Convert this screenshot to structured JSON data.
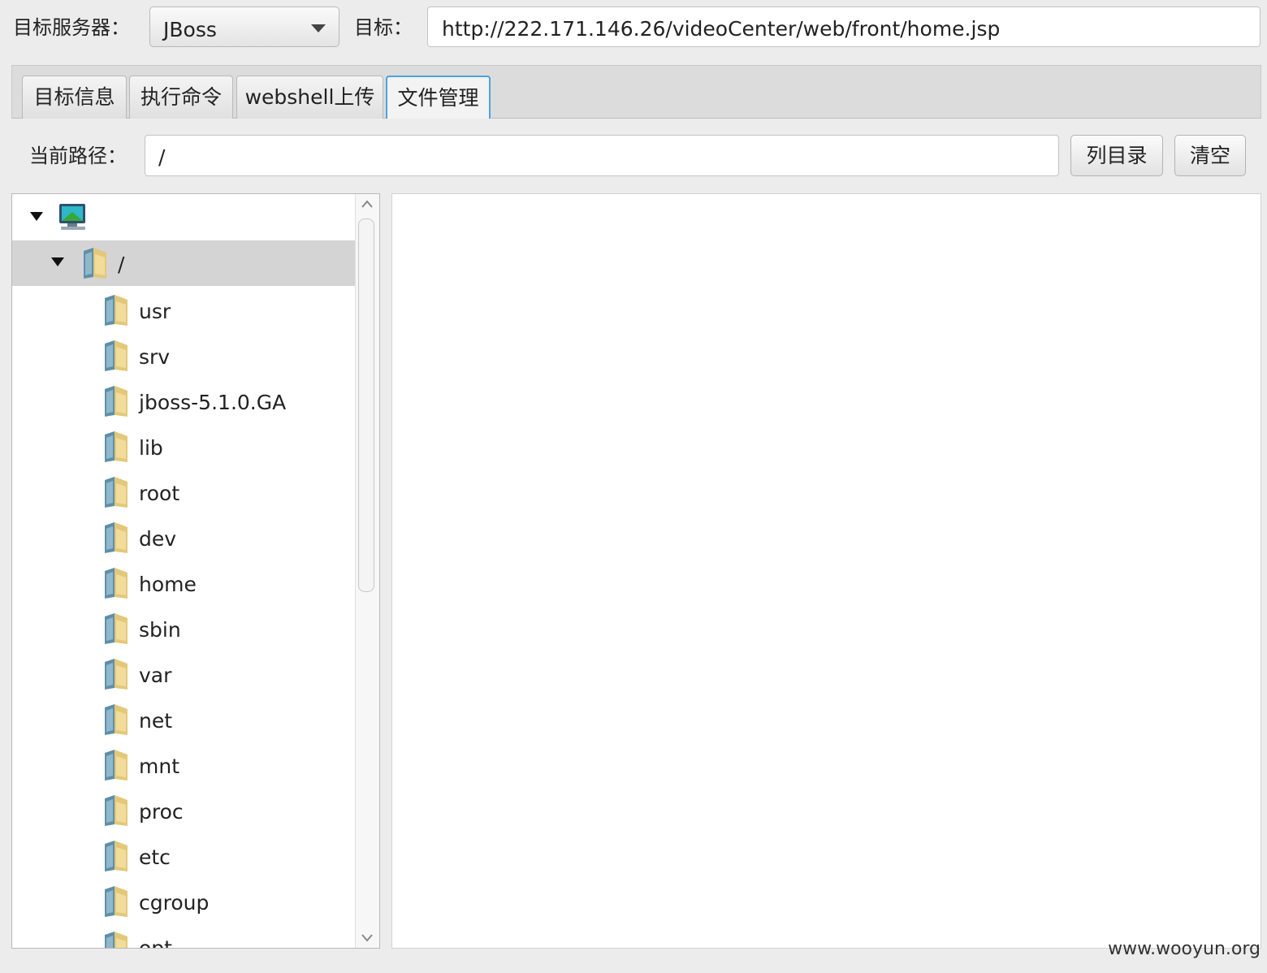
{
  "header": {
    "server_label": "目标服务器：",
    "server_value": "JBoss",
    "target_label": "目标：",
    "target_url": "http://222.171.146.26/videoCenter/web/front/home.jsp"
  },
  "tabs": [
    {
      "label": "目标信息",
      "active": false
    },
    {
      "label": "执行命令",
      "active": false
    },
    {
      "label": "webshell上传",
      "active": false
    },
    {
      "label": "文件管理",
      "active": true
    }
  ],
  "path_bar": {
    "label": "当前路径：",
    "value": "/",
    "list_button": "列目录",
    "clear_button": "清空"
  },
  "tree": {
    "root_icon": "computer-icon",
    "selected_dir": "/",
    "children": [
      "usr",
      "srv",
      "jboss-5.1.0.GA",
      "lib",
      "root",
      "dev",
      "home",
      "sbin",
      "var",
      "net",
      "mnt",
      "proc",
      "etc",
      "cgroup",
      "opt"
    ]
  },
  "watermark": "www.wooyun.org"
}
